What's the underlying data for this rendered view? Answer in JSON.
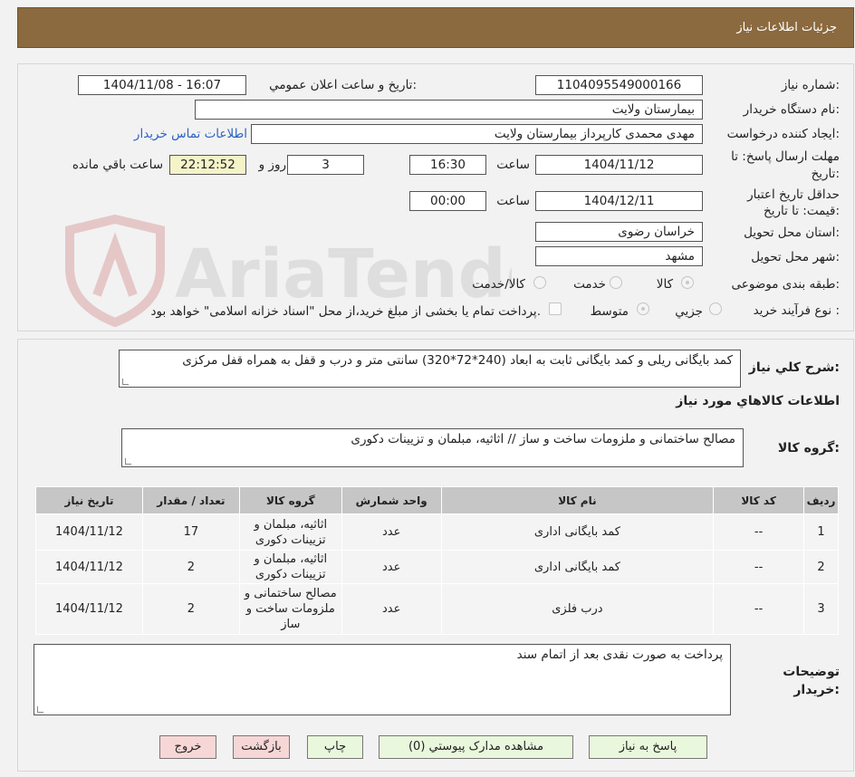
{
  "header": {
    "title": "جزئیات اطلاعات نیاز"
  },
  "form": {
    "need_number": {
      "label": "شماره نیاز:",
      "value": "1104095549000166"
    },
    "announce_datetime": {
      "label": "تاریخ و ساعت اعلان عمومي:",
      "value": "1404/11/08 - 16:07"
    },
    "buyer_org": {
      "label": "نام دستگاه خریدار:",
      "value": "بیمارستان ولایت"
    },
    "requester": {
      "label": "ایجاد کننده درخواست:",
      "value": "مهدی محمدی کارپرداز بیمارستان ولایت",
      "contact_link": "اطلاعات تماس خریدار"
    },
    "response_deadline": {
      "label": "مهلت ارسال پاسخ: تا تاریخ:",
      "date": "1404/11/12",
      "time_label": "ساعت",
      "time": "16:30",
      "days": "3",
      "days_label": "روز و",
      "remaining": "22:12:52",
      "remaining_label": "ساعت باقي مانده"
    },
    "price_validity": {
      "label": "حداقل تاریخ اعتبار قیمت: تا تاریخ:",
      "date": "1404/12/11",
      "time_label": "ساعت",
      "time": "00:00"
    },
    "province": {
      "label": "استان محل تحویل:",
      "value": "خراسان رضوی"
    },
    "city": {
      "label": "شهر محل تحویل:",
      "value": "مشهد"
    },
    "category": {
      "label": "طبقه بندی موضوعی:",
      "options": [
        "کالا",
        "خدمت",
        "کالا/خدمت"
      ]
    },
    "purchase_type": {
      "label": "نوع فرآیند خرید :",
      "options": [
        "جزیي",
        "متوسط"
      ],
      "note": "پرداخت تمام یا بخشی از مبلغ خرید،از محل \"اسناد خزانه اسلامی\" خواهد بود."
    }
  },
  "summary": {
    "label": "شرح کلي نياز:",
    "value": "کمد بایگانی ریلی و  کمد بایگانی ثابت به ابعاد  (240*72*320) سانتی متر و درب و قفل به همراه قفل مرکزی"
  },
  "goods_section_title": "اطلاعات کالاهاي مورد نياز",
  "goods_group": {
    "label": "گروه کالا:",
    "value": "مصالح ساختمانی و ملزومات ساخت و ساز // اثاثیه، مبلمان و تزیینات دکوری"
  },
  "table": {
    "headers": [
      "رديف",
      "کد کالا",
      "نام کالا",
      "واحد شمارش",
      "گروه کالا",
      "تعداد / مقدار",
      "تاریخ نیاز"
    ],
    "rows": [
      [
        "1",
        "--",
        "کمد بایگانی اداری",
        "عدد",
        "اثاثیه، مبلمان و تزیینات دکوری",
        "17",
        "1404/11/12"
      ],
      [
        "2",
        "--",
        "کمد بایگانی اداری",
        "عدد",
        "اثاثیه، مبلمان و تزیینات دکوری",
        "2",
        "1404/11/12"
      ],
      [
        "3",
        "--",
        "درب فلزی",
        "عدد",
        "مصالح ساختمانی و ملزومات ساخت و ساز",
        "2",
        "1404/11/12"
      ]
    ]
  },
  "buyer_notes": {
    "label": "توضيحات خريدار:",
    "value": "پرداخت به صورت نقدی بعد از اتمام سند"
  },
  "buttons": {
    "respond": "پاسخ به نیاز",
    "attachments": "مشاهده مدارک پیوستي (0)",
    "print": "چاپ",
    "back": "بازگشت",
    "exit": "خروج"
  },
  "watermark": {
    "text": "AriaTender.neT"
  },
  "colors": {
    "header": "#8b6a3f",
    "button_green": "#e9f7dc",
    "button_red": "#f7d6d6",
    "link": "#2b62c4",
    "time_field": "#f5f3c8"
  }
}
